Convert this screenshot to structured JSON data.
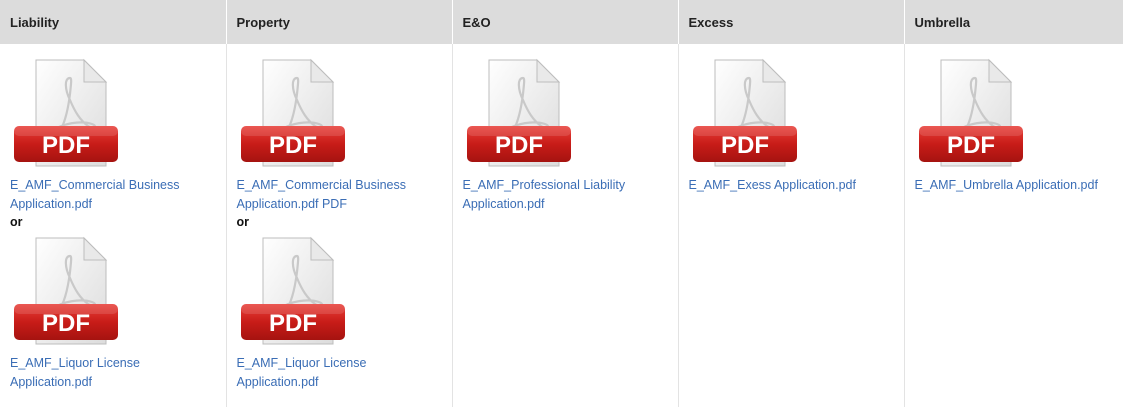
{
  "columns": [
    {
      "header": "Liability",
      "docs": [
        {
          "icon": "pdf-file-icon",
          "link": "E_AMF_Commercial Business Application.pdf"
        },
        {
          "icon": "pdf-file-icon",
          "link": "E_AMF_Liquor License Application.pdf"
        }
      ],
      "separator": "or"
    },
    {
      "header": "Property",
      "docs": [
        {
          "icon": "pdf-file-icon",
          "link": "E_AMF_Commercial Business Application.pdf PDF"
        },
        {
          "icon": "pdf-file-icon",
          "link": "E_AMF_Liquor License Application.pdf"
        }
      ],
      "separator": "or"
    },
    {
      "header": "E&O",
      "docs": [
        {
          "icon": "pdf-file-icon",
          "link": "E_AMF_Professional Liability Application.pdf"
        }
      ]
    },
    {
      "header": "Excess",
      "docs": [
        {
          "icon": "pdf-file-icon",
          "link": "E_AMF_Exess Application.pdf"
        }
      ]
    },
    {
      "header": "Umbrella",
      "docs": [
        {
          "icon": "pdf-file-icon",
          "link": "E_AMF_Umbrella Application.pdf"
        }
      ]
    }
  ],
  "icon_text": "PDF",
  "colors": {
    "header_bg": "#dcdcdc",
    "link": "#3a6db5",
    "pdf_red": "#cc1f1f"
  }
}
